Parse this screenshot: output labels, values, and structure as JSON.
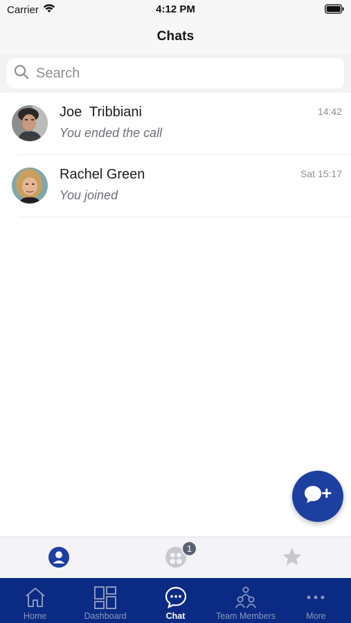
{
  "status_bar": {
    "carrier": "Carrier",
    "time": "4:12 PM"
  },
  "header": {
    "title": "Chats"
  },
  "search": {
    "placeholder": "Search",
    "value": ""
  },
  "chats": [
    {
      "name": "Joe  Tribbiani",
      "preview": "You ended the call",
      "time": "14:42"
    },
    {
      "name": "Rachel Green",
      "preview": "You joined",
      "time": "Sat 15:17"
    }
  ],
  "segments": [
    {
      "icon": "person-circle-icon",
      "active": true
    },
    {
      "icon": "group-circle-icon",
      "badge": "1",
      "active": false
    },
    {
      "icon": "star-icon",
      "active": false
    }
  ],
  "tab_bar": {
    "items": [
      {
        "label": "Home",
        "icon": "home-icon"
      },
      {
        "label": "Dashboard",
        "icon": "dashboard-icon"
      },
      {
        "label": "Chat",
        "icon": "chat-bubble-icon",
        "active": true
      },
      {
        "label": "Team Members",
        "icon": "team-members-icon"
      },
      {
        "label": "More",
        "icon": "more-dots-icon"
      }
    ]
  },
  "colors": {
    "brand_navy": "#0b2a83",
    "fab_blue": "#1d3fa0",
    "active_segment": "#1d3fa0",
    "inactive_icon": "#c8c8cf"
  }
}
